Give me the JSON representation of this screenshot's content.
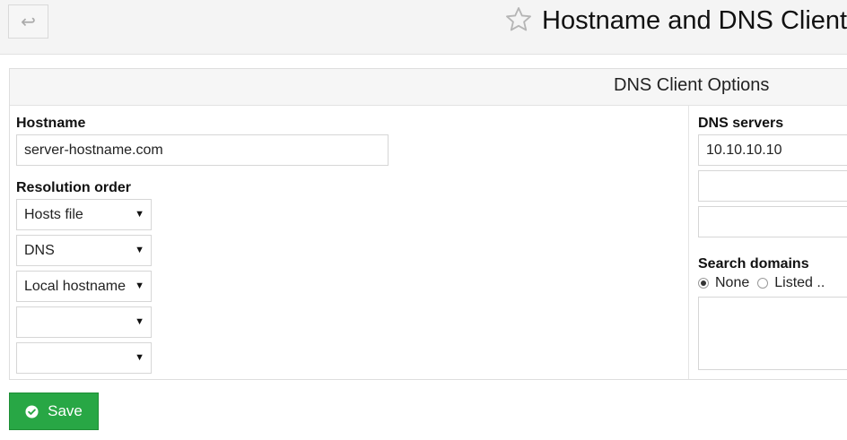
{
  "header": {
    "title": "Hostname and DNS Client",
    "back_glyph": "↩",
    "icons": [
      "back-arrow-icon",
      "star-icon"
    ]
  },
  "panel": {
    "title": "DNS Client Options",
    "hostname": {
      "label": "Hostname",
      "value": "server-hostname.com"
    },
    "resolution_order": {
      "label": "Resolution order",
      "selects": [
        "Hosts file",
        "DNS",
        "Local hostname",
        "",
        ""
      ]
    },
    "dns_servers": {
      "label": "DNS servers",
      "values": [
        "10.10.10.10",
        "",
        ""
      ]
    },
    "search_domains": {
      "label": "Search domains",
      "options": [
        {
          "label": "None",
          "checked": true
        },
        {
          "label": "Listed ..",
          "checked": false
        }
      ],
      "value": ""
    }
  },
  "actions": {
    "save_label": "Save",
    "save_icon": "check-circle-icon"
  },
  "colors": {
    "save_button": "#28a745",
    "header_bg": "#f4f4f4"
  }
}
